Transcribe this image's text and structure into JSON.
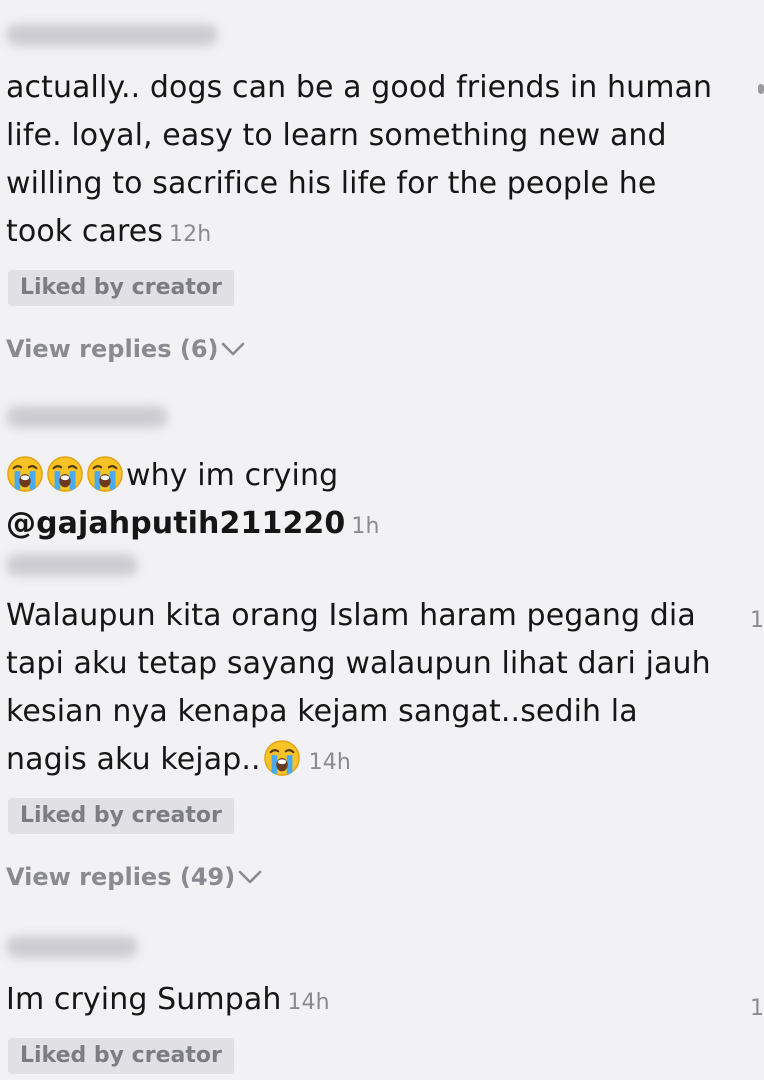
{
  "comments": [
    {
      "text": "actually.. dogs can be a good friends in human life. loyal, easy to learn something new and willing to sacrifice his life for the people he took cares",
      "time": "12h",
      "badge": "Liked by creator",
      "replies": "View replies (6)"
    },
    {
      "emojis": [
        "loudly-crying-face",
        "loudly-crying-face",
        "loudly-crying-face"
      ],
      "text": "why im crying",
      "mention": "@gajahputih211220",
      "time": "1h"
    },
    {
      "text": "Walaupun kita orang Islam haram pegang dia tapi aku tetap sayang walaupun lihat dari jauh kesian nya kenapa kejam sangat..sedih la nagis aku kejap..",
      "emoji": "loudly-crying-face",
      "time": "14h",
      "badge": "Liked by creator",
      "replies": "View replies (49)",
      "edge_count": "1"
    },
    {
      "text": "Im crying Sumpah",
      "time": "14h",
      "badge": "Liked by creator",
      "edge_count": "1"
    }
  ],
  "colors": {
    "background": "#f2f2f4",
    "text": "#161616",
    "muted": "#8a8a91",
    "badge_bg": "#e1e1e5",
    "badge_text": "#7c7c84"
  }
}
